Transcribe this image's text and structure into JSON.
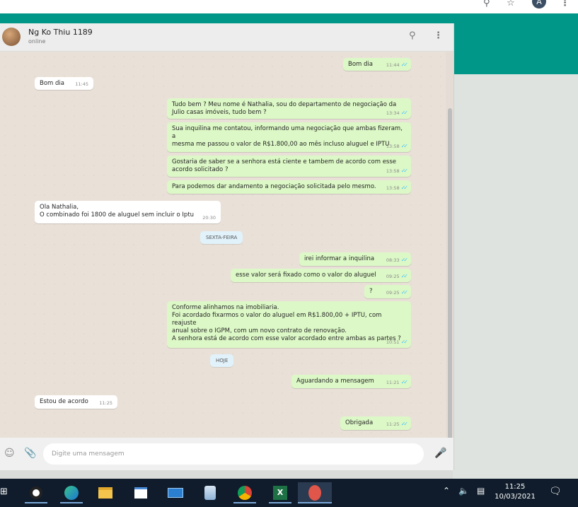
{
  "browser": {
    "zoom_icon": "magnifier-icon",
    "star_icon": "bookmark-star-icon",
    "profile_initial": "A",
    "menu_icon": "kebab-menu-icon"
  },
  "header": {
    "contact_name": "Ng Ko Thiu 1189",
    "status": "online"
  },
  "messages": [
    {
      "dir": "out",
      "text": "Bom dia",
      "time": "11:44",
      "ticks": true
    },
    {
      "dir": "in",
      "text": "Bom dia",
      "time": "11:45",
      "ticks": false
    },
    {
      "dir": "out",
      "text": "Tudo bem ? Meu nome é Nathalia, sou do departamento de negociação da\nJulio casas imóveis, tudo bem ?",
      "time": "13:34",
      "ticks": true
    },
    {
      "dir": "out",
      "text": "Sua inquilina me contatou, informando uma negociação que ambas fizeram, a\nmesma me passou o valor de R$1.800,00 ao mês incluso aluguel e IPTU",
      "time": "13:58",
      "ticks": true
    },
    {
      "dir": "out",
      "text": "Gostaria de saber se a senhora está ciente e tambem de acordo com esse\nacordo solicitado ?",
      "time": "13:58",
      "ticks": true
    },
    {
      "dir": "out",
      "text": " Para podemos dar andamento a negociação solicitada pelo mesmo.",
      "time": "13:58",
      "ticks": true
    },
    {
      "dir": "in",
      "text": "Ola Nathalia,\nO combinado foi 1800 de aluguel sem incluir o Iptu",
      "time": "20:30",
      "ticks": false
    },
    {
      "dir": "out",
      "text": "irei informar a inquilina",
      "time": "08:33",
      "ticks": true
    },
    {
      "dir": "out",
      "text": "esse valor será fixado como o valor do aluguel",
      "time": "09:25",
      "ticks": true
    },
    {
      "dir": "out",
      "text": "?",
      "time": "09:25",
      "ticks": true
    },
    {
      "dir": "out",
      "text": "Conforme alinhamos na imobiliaria.\nFoi acordado fixarmos o valor do aluguel em R$1.800,00 + IPTU, com reajuste\nanual sobre o IGPM, com um novo contrato de renovação.\nA senhora está de acordo com esse valor acordado entre ambas as partes ?",
      "time": "10:51",
      "ticks": true
    },
    {
      "dir": "out",
      "text": "Aguardando a mensagem",
      "time": "11:21",
      "ticks": true
    },
    {
      "dir": "in",
      "text": "Estou de acordo",
      "time": "11:25",
      "ticks": false
    },
    {
      "dir": "out",
      "text": "Obrigada",
      "time": "11:25",
      "ticks": true
    }
  ],
  "day_separators": [
    "SEXTA-FEIRA",
    "HOJE"
  ],
  "compose": {
    "placeholder": "Digite uma mensagem"
  },
  "taskbar": {
    "apps": [
      "cortana-icon",
      "edge-icon",
      "file-explorer-icon",
      "store-icon",
      "mail-icon",
      "app-icon",
      "chrome-icon",
      "excel-icon",
      "app-active-icon"
    ],
    "time": "11:25",
    "date": "10/03/2021"
  },
  "colors": {
    "teal": "#009688",
    "outgoing_bubble": "#dcf8c6",
    "incoming_bubble": "#ffffff",
    "read_ticks": "#4fc3f7"
  }
}
